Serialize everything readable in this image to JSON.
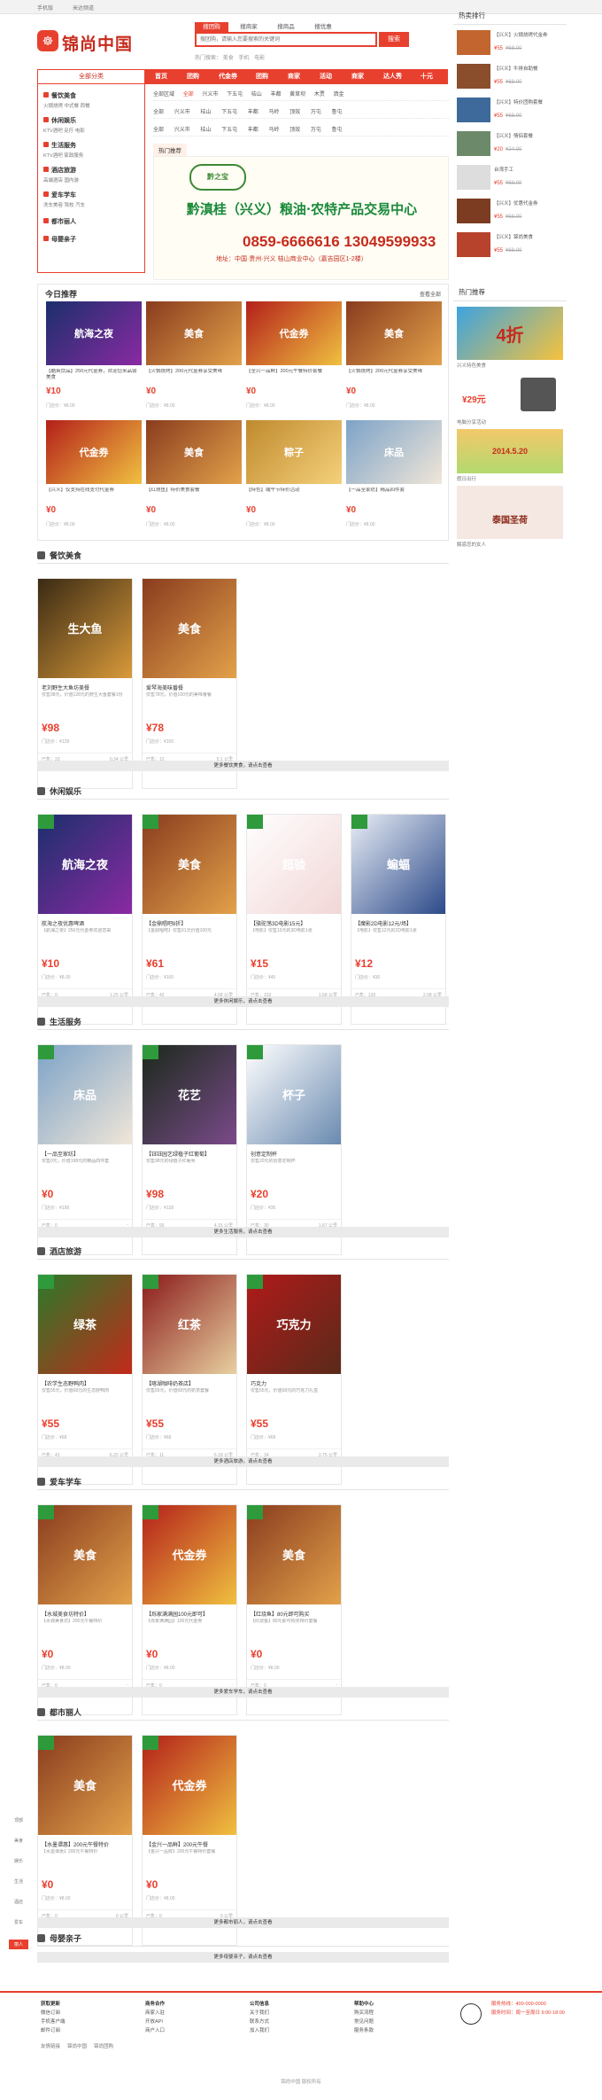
{
  "topbar": {
    "left": "手机版",
    "center": "米达频道"
  },
  "logo": {
    "text": "锦尚中国"
  },
  "search": {
    "tabs": [
      "搜团购",
      "搜商家",
      "搜商品",
      "搜优惠"
    ],
    "placeholder": "搜团购，请输入您要搜索的关键词",
    "button": "搜索",
    "hot_label": "热门搜索：",
    "hot_words": [
      "美食",
      "手机",
      "电影"
    ]
  },
  "nav": {
    "all_categories": "全部分类",
    "items": [
      "首页",
      "团购",
      "代金券",
      "团购",
      "商家",
      "活动",
      "商家",
      "达人秀",
      "十元"
    ]
  },
  "categories": [
    {
      "title": "餐饮美食",
      "subs": [
        "火锅烧烤",
        "中式餐",
        "西餐"
      ]
    },
    {
      "title": "休闲娱乐",
      "subs": [
        "KTV酒吧",
        "足疗",
        "电影"
      ]
    },
    {
      "title": "生活服务",
      "subs": [
        "KTV酒吧",
        "家政服务"
      ]
    },
    {
      "title": "酒店旅游",
      "subs": [
        "高端酒店",
        "国内游"
      ]
    },
    {
      "title": "爱车学车",
      "subs": [
        "洗车美容",
        "驾校",
        "汽车"
      ]
    },
    {
      "title": "都市丽人",
      "subs": []
    },
    {
      "title": "母婴亲子",
      "subs": []
    }
  ],
  "filters": {
    "rows": [
      [
        "全部区域",
        "兴义市",
        "下五屯",
        "桔山",
        "丰都",
        "黄草坝",
        "木贾",
        "洒金",
        "马岭",
        "顶效"
      ],
      [
        "全部",
        "兴义市",
        "桔山",
        "下五屯",
        "丰都",
        "马岭",
        "顶效",
        "万屯",
        "鲁屯",
        "全部"
      ],
      [
        "全部",
        "兴义市",
        "桔山",
        "下五屯",
        "丰都",
        "马岭",
        "顶效",
        "万屯",
        "鲁屯",
        "全部"
      ]
    ],
    "active": "全部",
    "hot_label": "热门推荐"
  },
  "banner": {
    "logo": "黔之宝",
    "title": "黔滇桂（兴义）粮油·农特产品交易中心",
    "phone": "0859-6666616 13049599933",
    "addr": "地址：中国·贵州·兴义 桔山商业中心（嘉吉园区1-2楼）"
  },
  "rank": {
    "title": "热卖排行",
    "items": [
      {
        "title": "【兴义】火锅烧烤代金券",
        "price": "¥55",
        "old": "¥68.00"
      },
      {
        "title": "【兴义】牛排自助餐",
        "price": "¥55",
        "old": "¥68.00"
      },
      {
        "title": "【兴义】特价团购套餐",
        "price": "¥55",
        "old": "¥68.00"
      },
      {
        "title": "【兴义】情侣套餐",
        "price": "¥20",
        "old": "¥24.00"
      },
      {
        "title": "台湾手工",
        "price": "¥55",
        "old": "¥68.00"
      },
      {
        "title": "【兴义】优惠代金券",
        "price": "¥55",
        "old": "¥68.00"
      },
      {
        "title": "【兴义】锦尚美食",
        "price": "¥55",
        "old": "¥68.00"
      }
    ]
  },
  "hot": {
    "title": "热门推荐",
    "ads": [
      "4折",
      "¥29元",
      "2014.5.20",
      "泰国圣荷"
    ],
    "captions": [
      "兴义特色美食",
      "电脑分享活动",
      "假日出行",
      "解惑您的女人"
    ]
  },
  "today": {
    "title": "今日推荐",
    "more": "查看全部",
    "items": [
      {
        "img": "航海之夜",
        "text": "【酷爽饮品】250元代金券，欢迎您来品尝美食",
        "price": "¥10",
        "old": "门店价：¥8.00"
      },
      {
        "img": "美食",
        "text": "【火锅烧烤】200元代金券享受美味",
        "price": "¥0",
        "old": "门店价：¥8.00"
      },
      {
        "img": "代金券",
        "text": "【全兴一品鲜】200元午餐特价套餐",
        "price": "¥0",
        "old": "门店价：¥8.00"
      },
      {
        "img": "美食",
        "text": "【火锅烧烤】200元代金券享受美味",
        "price": "¥0",
        "old": "门店价：¥8.00"
      },
      {
        "img": "代金券",
        "text": "【兴义】仅支持在线支付代金券",
        "price": "¥0",
        "old": "门店价：¥8.00"
      },
      {
        "img": "美食",
        "text": "【红烧鱼】特价美食套餐",
        "price": "¥0",
        "old": "门店价：¥8.00"
      },
      {
        "img": "粽子",
        "text": "【特色】端午节特价活动",
        "price": "¥0",
        "old": "门店价：¥8.00"
      },
      {
        "img": "床品",
        "text": "【一品至家纺】精品四件套",
        "price": "¥0",
        "old": "门店价：¥8.00"
      }
    ]
  },
  "sections": [
    {
      "title": "餐饮美食",
      "more": "更多餐饮美食，请点击查看",
      "cards": [
        {
          "img": "生大鱼",
          "title": "老刘野生大鱼坊美餐",
          "desc": "仅售98元，价值128元的野生大鱼套餐1份",
          "price": "¥98",
          "op": "门店价：¥128",
          "sold": "已售：23",
          "dist": "0.34 公里"
        },
        {
          "img": "美食",
          "title": "爱琴海美味番餐",
          "desc": "仅售78元，价值100元的美味番餐",
          "price": "¥78",
          "op": "门店价：¥100",
          "sold": "已售：12",
          "dist": "5.1 公里"
        }
      ]
    },
    {
      "title": "休闲娱乐",
      "more": "更多休闲娱乐，请点击查看",
      "cards": [
        {
          "img": "航海之夜",
          "title": "航海之夜优惠啤酒",
          "desc": "【航海之夜】250元代金券欢迎您来",
          "price": "¥10",
          "op": "门店价：¥8.00",
          "sold": "已售：0",
          "dist": "1.25 公里"
        },
        {
          "img": "美食",
          "title": "【金鼎唱吧8折】",
          "desc": "【金鼎唱吧】仅售61元价值100元",
          "price": "¥61",
          "op": "门店价：¥100",
          "sold": "已售：42",
          "dist": "4.08 公里"
        },
        {
          "img": "超验",
          "title": "【骆驼荡3D电影15元】",
          "desc": "【电影】仅售15元的3D电影1张",
          "price": "¥15",
          "op": "门店价：¥45",
          "sold": "已售：103",
          "dist": "1.68 公里"
        },
        {
          "img": "蝙蝠",
          "title": "【魔影2D电影12元/场】",
          "desc": "【电影】仅售12元的2D电影1张",
          "price": "¥12",
          "op": "门店价：¥30",
          "sold": "已售：120",
          "dist": "2.08 公里"
        }
      ]
    },
    {
      "title": "生活服务",
      "more": "更多生活服务，请点击查看",
      "cards": [
        {
          "img": "床品",
          "title": "【一品至家纺】",
          "desc": "仅售0元，价值198元的精品四件套",
          "price": "¥0",
          "op": "门店价：¥198",
          "sold": "已售：0",
          "dist": "-"
        },
        {
          "img": "花艺",
          "title": "【钰钰园艺绿植子红葡萄】",
          "desc": "仅售98元的绿植子红葡萄",
          "price": "¥98",
          "op": "门店价：¥128",
          "sold": "已售：56",
          "dist": "4.15 公里"
        },
        {
          "img": "杯子",
          "title": "创意定制杯",
          "desc": "仅售20元的创意定制杯",
          "price": "¥20",
          "op": "门店价：¥35",
          "sold": "已售：30",
          "dist": "1.67 公里"
        }
      ]
    },
    {
      "title": "酒店旅游",
      "more": "更多酒店旅游，请点击查看",
      "cards": [
        {
          "img": "绿茶",
          "title": "【农学生态野鸭肉】",
          "desc": "仅售55元，价值68元的生态野鸭肉",
          "price": "¥55",
          "op": "门店价：¥68",
          "sold": "已售：41",
          "dist": "6.25 公里"
        },
        {
          "img": "红茶",
          "title": "【喀湖咖啡奶茶店】",
          "desc": "仅售55元，价值68元的奶茶套餐",
          "price": "¥55",
          "op": "门店价：¥68",
          "sold": "已售：11",
          "dist": "6.18 公里"
        },
        {
          "img": "巧克力",
          "title": "巧克力",
          "desc": "仅售55元，价值68元的巧克力礼盒",
          "price": "¥55",
          "op": "门店价：¥68",
          "sold": "已售：24",
          "dist": "3.75 公里"
        }
      ]
    },
    {
      "title": "爱车学车",
      "more": "更多爱车学车，请点击查看",
      "cards": [
        {
          "img": "美食",
          "title": "【水城美食坊特价】",
          "desc": "【水城美食坊】200元午餐特价",
          "price": "¥0",
          "op": "门店价：¥8.00",
          "sold": "已售：0",
          "dist": "-"
        },
        {
          "img": "代金券",
          "title": "【烁家满满园100元即可】",
          "desc": "【烁家满满园】100元代金券",
          "price": "¥0",
          "op": "门店价：¥8.00",
          "sold": "已售：0",
          "dist": "-"
        },
        {
          "img": "美食",
          "title": "【红烧鱼】80元即可购买",
          "desc": "【红烧鱼】80元即可购买特价套餐",
          "price": "¥0",
          "op": "门店价：¥8.00",
          "sold": "已售：0",
          "dist": "-"
        }
      ]
    },
    {
      "title": "都市丽人",
      "more": "更多都市丽人，请点击查看",
      "cards": [
        {
          "img": "美食",
          "title": "【水墨谭惠】200元午餐特价",
          "desc": "【水墨谭惠】200元午餐特价",
          "price": "¥0",
          "op": "门店价：¥8.00",
          "sold": "已售：0",
          "dist": "0 公里"
        },
        {
          "img": "代金券",
          "title": "【金兴一品鲜】200元午餐",
          "desc": "【金兴一品鲜】200元午餐特价套餐",
          "price": "¥0",
          "op": "门店价：¥8.00",
          "sold": "已售：0",
          "dist": "0 公里"
        }
      ]
    },
    {
      "title": "母婴亲子",
      "more": "更多母婴亲子，请点击查看",
      "cards": []
    }
  ],
  "footer": {
    "cols": [
      {
        "title": "获取更新",
        "items": [
          "微信订阅",
          "手机客户端",
          "邮件订阅"
        ]
      },
      {
        "title": "商务合作",
        "items": [
          "商家入驻",
          "开放API",
          "商户入口"
        ]
      },
      {
        "title": "公司信息",
        "items": [
          "关于我们",
          "联系方式",
          "加入我们"
        ]
      },
      {
        "title": "帮助中心",
        "items": [
          "购买流程",
          "常见问题",
          "服务条款"
        ]
      }
    ],
    "service_hours": "服务热线：400-000-0000",
    "service_time": "服务时间：周一至周日 9:00-18:00",
    "links": [
      "友情链接",
      "锦尚中国",
      "锦尚团购"
    ],
    "copyright": "锦尚中国 版权所有"
  },
  "sidebar": [
    "顶部",
    "美食",
    "娱乐",
    "生活",
    "酒店",
    "爱车",
    "丽人"
  ]
}
